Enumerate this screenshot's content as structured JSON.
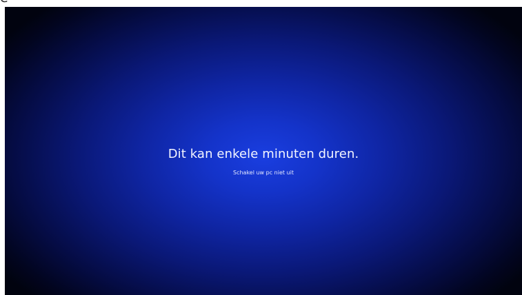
{
  "top_strip": {
    "text": "e"
  },
  "update_screen": {
    "message": "Dit kan enkele minuten duren.",
    "submessage": "Schakel uw pc niet uit"
  },
  "colors": {
    "center_blue": "#1a3ee0",
    "edge_dark": "#01030f",
    "text": "#ffffff"
  }
}
